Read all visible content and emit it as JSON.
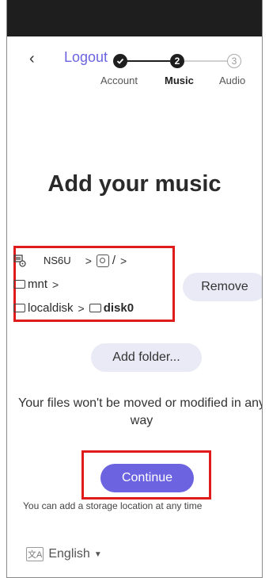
{
  "header": {
    "back_icon": "chevron-left-icon",
    "logout_label": "Logout"
  },
  "stepper": {
    "steps": [
      {
        "label": "Account",
        "marker": "",
        "state": "done"
      },
      {
        "label": "Music",
        "marker": "2",
        "state": "current"
      },
      {
        "label": "Audio",
        "marker": "3",
        "state": "upcoming"
      }
    ]
  },
  "main": {
    "title": "Add your music",
    "path": {
      "device_name": "NS6U",
      "root_label": "/",
      "folders": [
        "mnt",
        "localdisk",
        "disk0"
      ],
      "separator": ">"
    },
    "remove_label": "Remove",
    "add_folder_label": "Add folder...",
    "info_text": "Your files won't be moved or modified in any way",
    "continue_label": "Continue",
    "hint_text": "You can add a storage location at any time"
  },
  "footer": {
    "language_label": "English",
    "language_icon": "translate-icon"
  },
  "colors": {
    "accent": "#6b63e0",
    "highlight_box": "#e01b1b",
    "button_bg": "#e9eaf5",
    "topbar": "#1e1e1e"
  }
}
